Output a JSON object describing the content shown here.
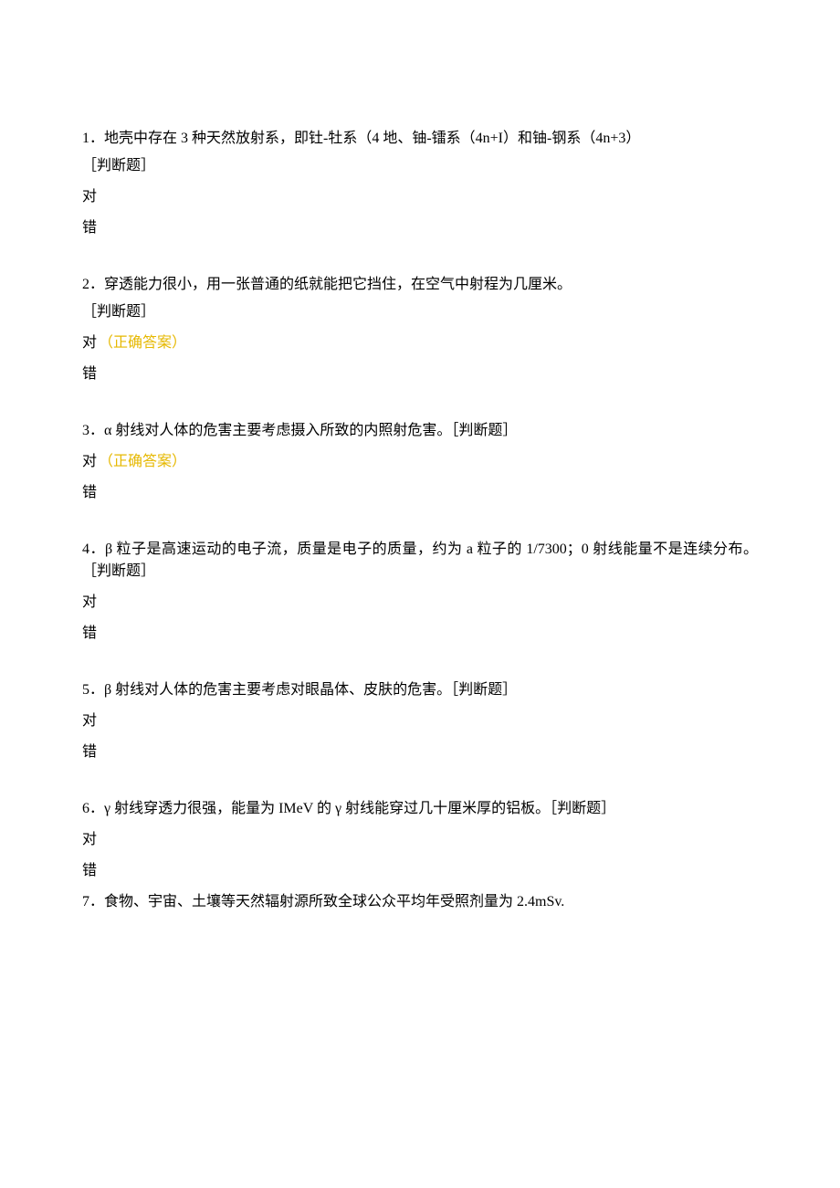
{
  "questions": [
    {
      "number": "1",
      "lines": [
        "．地壳中存在 3 种天然放射系，即钍-牡系（4 地、铀-镭系（4n+I）和铀-钢系（4n+3）",
        "［判断题］"
      ],
      "options": [
        {
          "label": "对",
          "correct": false
        },
        {
          "label": "错",
          "correct": false
        }
      ]
    },
    {
      "number": "2",
      "lines": [
        "．穿透能力很小，用一张普通的纸就能把它挡住，在空气中射程为几厘米。",
        "［判断题］"
      ],
      "options": [
        {
          "label": "对",
          "correct": true,
          "correct_text": "（正确答案）"
        },
        {
          "label": "错",
          "correct": false
        }
      ]
    },
    {
      "number": "3",
      "lines": [
        "．α 射线对人体的危害主要考虑摄入所致的内照射危害。［判断题］"
      ],
      "options": [
        {
          "label": "对",
          "correct": true,
          "correct_text": "（正确答案）"
        },
        {
          "label": "错",
          "correct": false
        }
      ]
    },
    {
      "number": "4",
      "lines": [
        "．β 粒子是高速运动的电子流，质量是电子的质量，约为 a 粒子的 1/7300；0 射线能量不是连续分布。［判断题］"
      ],
      "options": [
        {
          "label": "对",
          "correct": false
        },
        {
          "label": "错",
          "correct": false
        }
      ]
    },
    {
      "number": "5",
      "lines": [
        "．β 射线对人体的危害主要考虑对眼晶体、皮肤的危害。［判断题］"
      ],
      "options": [
        {
          "label": "对",
          "correct": false
        },
        {
          "label": "错",
          "correct": false
        }
      ]
    },
    {
      "number": "6",
      "lines": [
        "．γ 射线穿透力很强，能量为 IMeV 的 γ 射线能穿过几十厘米厚的铝板。［判断题］"
      ],
      "options": [
        {
          "label": "对",
          "correct": false
        },
        {
          "label": "错",
          "correct": false
        }
      ],
      "trailing": {
        "number": "7",
        "text": "．食物、宇宙、土壤等天然辐射源所致全球公众平均年受照剂量为 2.4mSv."
      }
    }
  ]
}
